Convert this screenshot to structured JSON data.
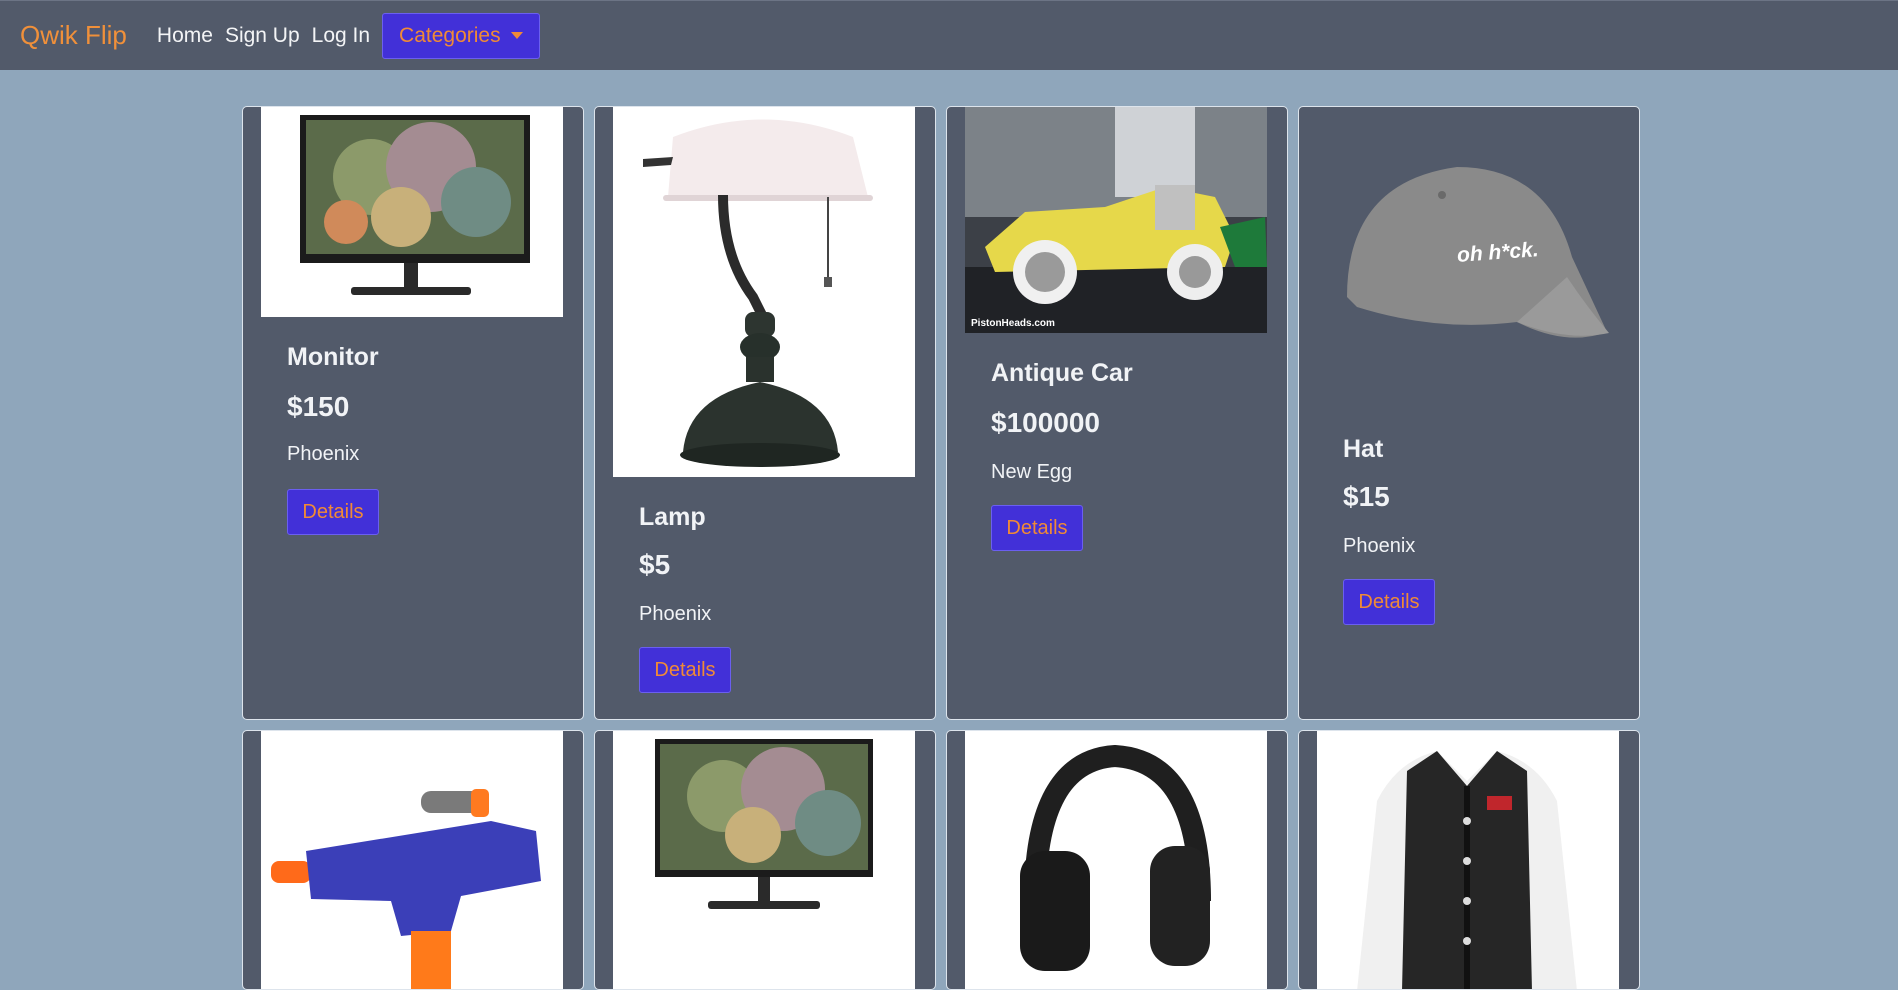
{
  "nav": {
    "brand": "Qwik Flip",
    "links": [
      "Home",
      "Sign Up",
      "Log In"
    ],
    "categories_label": "Categories"
  },
  "products": [
    {
      "title": "Monitor",
      "price": "$150",
      "location": "Phoenix",
      "button": "Details",
      "image": "monitor-image"
    },
    {
      "title": "Lamp",
      "price": "$5",
      "location": "Phoenix",
      "button": "Details",
      "image": "lamp-image"
    },
    {
      "title": "Antique Car",
      "price": "$100000",
      "location": "New Egg",
      "button": "Details",
      "image": "antique-car-image",
      "image_caption": "PistonHeads.com"
    },
    {
      "title": "Hat",
      "price": "$15",
      "location": "Phoenix",
      "button": "Details",
      "image": "hat-image",
      "image_caption": "oh h*ck."
    }
  ],
  "second_row_images": [
    "toy-blaster-image",
    "monitor-image",
    "headphones-image",
    "varsity-jacket-image"
  ],
  "colors": {
    "background": "#8fa6bb",
    "navbar": "#525a6a",
    "card": "#525a6a",
    "brand": "#f0903a",
    "button_bg": "#4230d8",
    "button_text": "#f08a36"
  }
}
